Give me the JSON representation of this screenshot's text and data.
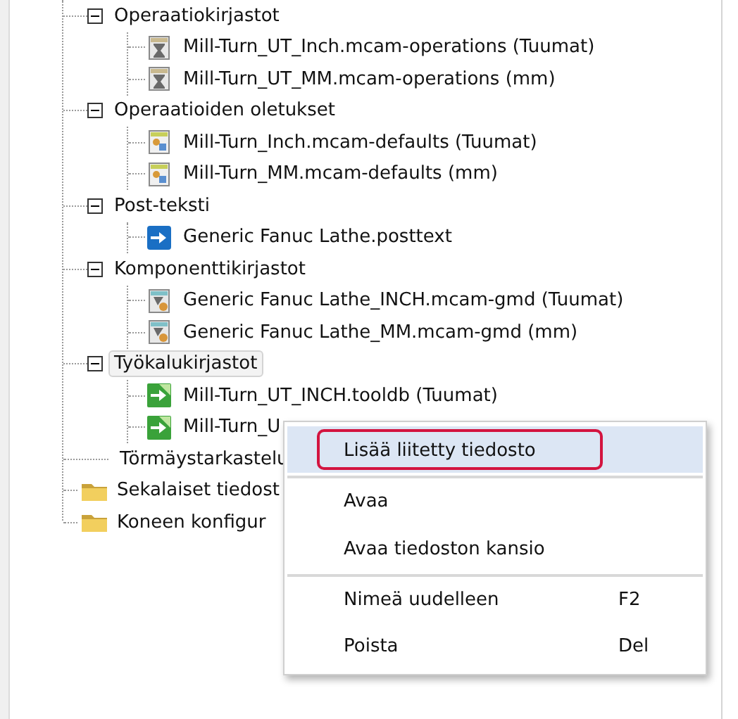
{
  "tree": [
    {
      "kind": "group",
      "label": "Operaatiokirjastot",
      "expanded": true,
      "selected": false,
      "children": [
        {
          "kind": "operations",
          "label": "Mill-Turn_UT_Inch.mcam-operations (Tuumat)"
        },
        {
          "kind": "operations",
          "label": "Mill-Turn_UT_MM.mcam-operations (mm)"
        }
      ]
    },
    {
      "kind": "group",
      "label": "Operaatioiden oletukset",
      "expanded": true,
      "selected": false,
      "children": [
        {
          "kind": "defaults",
          "label": "Mill-Turn_Inch.mcam-defaults (Tuumat)"
        },
        {
          "kind": "defaults",
          "label": "Mill-Turn_MM.mcam-defaults (mm)"
        }
      ]
    },
    {
      "kind": "group",
      "label": "Post-teksti",
      "expanded": true,
      "selected": false,
      "children": [
        {
          "kind": "post",
          "label": "Generic Fanuc Lathe.posttext"
        }
      ]
    },
    {
      "kind": "group",
      "label": "Komponenttikirjastot",
      "expanded": true,
      "selected": false,
      "children": [
        {
          "kind": "component",
          "label": "Generic Fanuc Lathe_INCH.mcam-gmd (Tuumat)"
        },
        {
          "kind": "component",
          "label": "Generic Fanuc Lathe_MM.mcam-gmd (mm)"
        }
      ]
    },
    {
      "kind": "group",
      "label": "Työkalukirjastot",
      "expanded": true,
      "selected": true,
      "children": [
        {
          "kind": "tool",
          "label": "Mill-Turn_UT_INCH.tooldb (Tuumat)"
        },
        {
          "kind": "tool",
          "label": "Mill-Turn_U"
        }
      ]
    },
    {
      "kind": "leaf",
      "label": "Törmäystarkastelu",
      "selected": false
    },
    {
      "kind": "folder",
      "label": "Sekalaiset tiedost",
      "selected": false
    },
    {
      "kind": "folder",
      "label": "Koneen konfigur",
      "selected": false
    }
  ],
  "context_menu": {
    "items": [
      {
        "label": "Lisää liitetty tiedosto",
        "selected": true,
        "outlined": true,
        "separator_after": true
      },
      {
        "label": "Avaa",
        "selected": false,
        "outlined": false,
        "separator_after": false
      },
      {
        "label": "Avaa tiedoston kansio",
        "selected": false,
        "outlined": false,
        "separator_after": true
      },
      {
        "label": "Nimeä uudelleen",
        "shortcut": "F2",
        "selected": false,
        "outlined": false,
        "separator_after": false
      },
      {
        "label": "Poista",
        "shortcut": "Del",
        "selected": false,
        "outlined": false,
        "separator_after": false
      }
    ]
  }
}
